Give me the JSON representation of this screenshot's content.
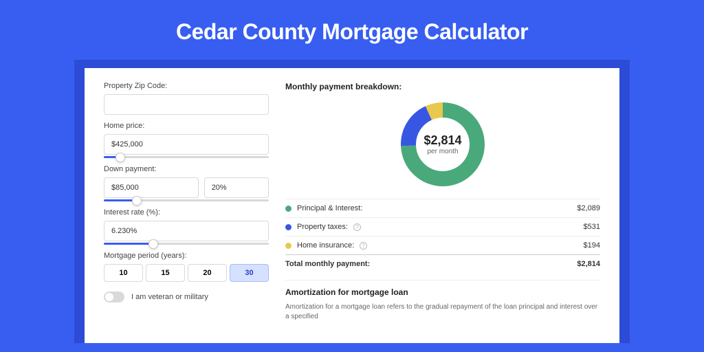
{
  "hero": {
    "title": "Cedar County Mortgage Calculator"
  },
  "form": {
    "zip_label": "Property Zip Code:",
    "zip_value": "",
    "price_label": "Home price:",
    "price_value": "$425,000",
    "price_slider_pct": 10,
    "down_label": "Down payment:",
    "down_value": "$85,000",
    "down_pct_value": "20%",
    "down_slider_pct": 20,
    "rate_label": "Interest rate (%):",
    "rate_value": "6.230%",
    "rate_slider_pct": 30,
    "period_label": "Mortgage period (years):",
    "periods": [
      "10",
      "15",
      "20",
      "30"
    ],
    "period_active": "30",
    "veteran_label": "I am veteran or military"
  },
  "breakdown": {
    "title": "Monthly payment breakdown:",
    "center_amount": "$2,814",
    "center_sub": "per month",
    "rows": [
      {
        "label": "Principal & Interest:",
        "amount": "$2,089",
        "color": "#4aa97a",
        "info": false
      },
      {
        "label": "Property taxes:",
        "amount": "$531",
        "color": "#3757e3",
        "info": true
      },
      {
        "label": "Home insurance:",
        "amount": "$194",
        "color": "#e9c84e",
        "info": true
      }
    ],
    "total_label": "Total monthly payment:",
    "total_amount": "$2,814"
  },
  "amort": {
    "title": "Amortization for mortgage loan",
    "text": "Amortization for a mortgage loan refers to the gradual repayment of the loan principal and interest over a specified"
  },
  "chart_data": {
    "type": "pie",
    "title": "Monthly payment breakdown",
    "series": [
      {
        "name": "Principal & Interest",
        "value": 2089,
        "color": "#4aa97a"
      },
      {
        "name": "Property taxes",
        "value": 531,
        "color": "#3757e3"
      },
      {
        "name": "Home insurance",
        "value": 194,
        "color": "#e9c84e"
      }
    ],
    "total": 2814
  }
}
